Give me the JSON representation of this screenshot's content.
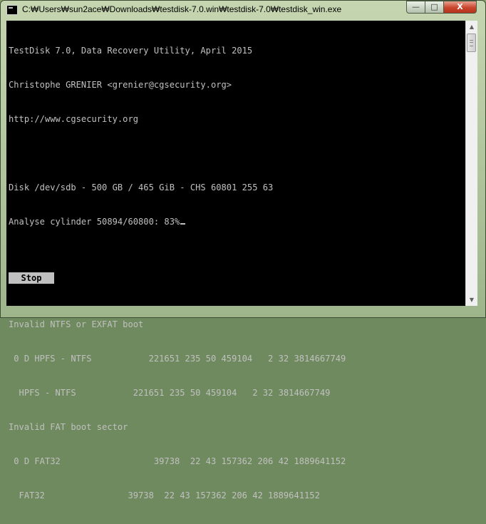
{
  "window": {
    "title": "C:₩Users₩sun2ace₩Downloads₩testdisk-7.0.win₩testdisk-7.0₩testdisk_win.exe",
    "controls": {
      "minimize": "—",
      "maximize": "□",
      "close": "X"
    }
  },
  "console": {
    "lines": [
      "TestDisk 7.0, Data Recovery Utility, April 2015",
      "Christophe GRENIER <grenier@cgsecurity.org>",
      "http://www.cgsecurity.org",
      "",
      "Disk /dev/sdb - 500 GB / 465 GiB - CHS 60801 255 63",
      "Analyse cylinder 50894/60800: 83%",
      "",
      "",
      "Invalid NTFS or EXFAT boot",
      " 0 D HPFS - NTFS           221651 235 50 459104   2 32 3814667749",
      "  HPFS - NTFS           221651 235 50 459104   2 32 3814667749",
      "Invalid FAT boot sector",
      " 0 D FAT32                  39738  22 43 157362 206 42 1889641152",
      "  FAT32                39738  22 43 157362 206 42 1889641152"
    ],
    "stop_label": "Stop"
  },
  "colors": {
    "console_bg": "#000000",
    "console_fg": "#c0c0c0",
    "close_button": "#c9452c"
  }
}
